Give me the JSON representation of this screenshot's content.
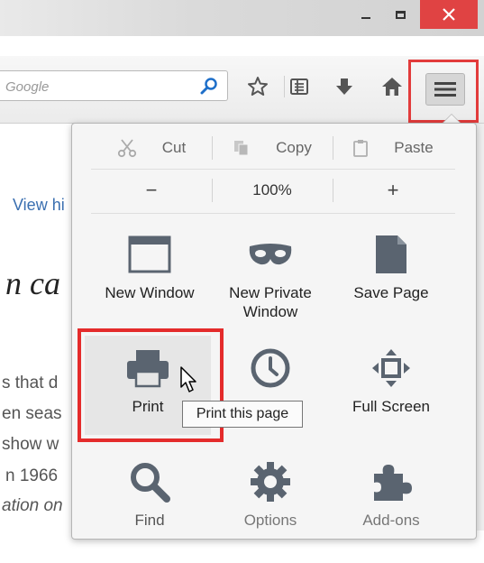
{
  "window": {
    "controls": [
      "minimize",
      "maximize",
      "close"
    ]
  },
  "toolbar": {
    "search_placeholder": "Google",
    "icons": [
      "bookmark-star-icon",
      "reading-list-icon",
      "download-icon",
      "home-icon",
      "hamburger-menu-icon"
    ]
  },
  "page_background": {
    "fragments": [
      "View hi",
      "n ca",
      "s that d",
      "en seas",
      "show w",
      "n 1966",
      "ation on"
    ]
  },
  "menu": {
    "edit_row": {
      "cut": "Cut",
      "copy": "Copy",
      "paste": "Paste"
    },
    "zoom_row": {
      "minus": "−",
      "level": "100%",
      "plus": "+"
    },
    "tiles": [
      {
        "label": "New Window",
        "icon": "window-icon"
      },
      {
        "label": "New Private Window",
        "icon": "mask-icon"
      },
      {
        "label": "Save Page",
        "icon": "page-icon"
      },
      {
        "label": "Print",
        "icon": "printer-icon"
      },
      {
        "label": "History",
        "icon": "clock-icon"
      },
      {
        "label": "Full Screen",
        "icon": "fullscreen-icon"
      },
      {
        "label": "Find",
        "icon": "magnifier-icon"
      },
      {
        "label": "Options",
        "icon": "gear-icon"
      },
      {
        "label": "Add-ons",
        "icon": "puzzle-icon"
      }
    ],
    "tooltip": "Print this page"
  },
  "colors": {
    "highlight_red": "#e42b2b",
    "close_red": "#e04343",
    "icon_gray": "#5a6470"
  }
}
